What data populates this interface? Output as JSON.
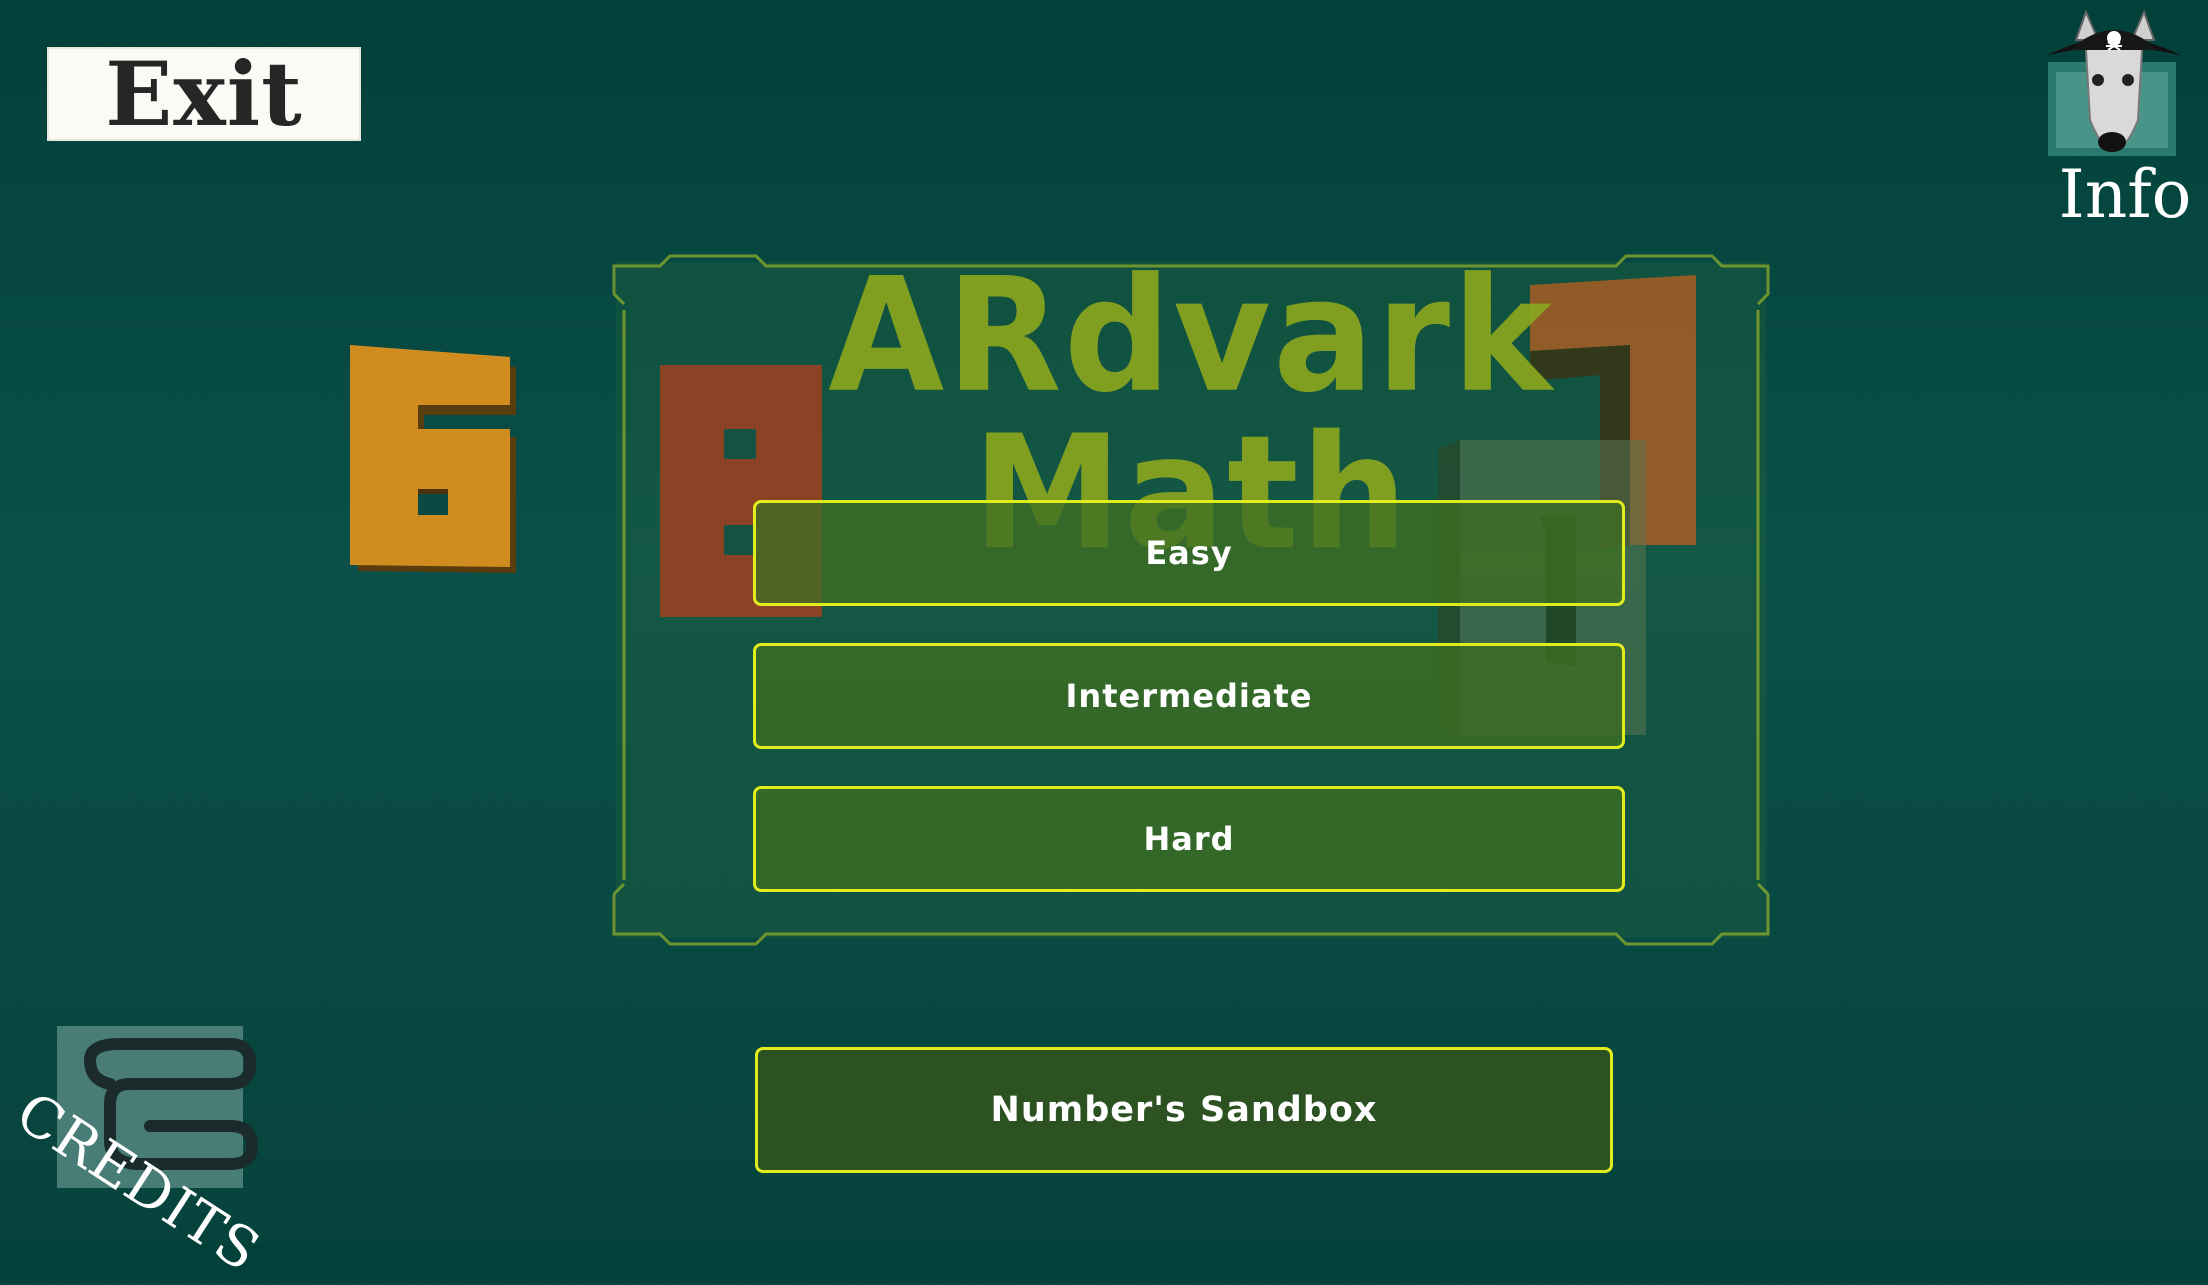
{
  "header": {
    "exit_label": "Exit",
    "info_label": "Info"
  },
  "title": "ARdvark Math",
  "menu": {
    "easy_label": "Easy",
    "intermediate_label": "Intermediate",
    "hard_label": "Hard",
    "sandbox_label": "Number's Sandbox"
  },
  "credits_label": "CREDITS",
  "decor": {
    "numbers": [
      "6",
      "8",
      "7",
      "1"
    ]
  },
  "colors": {
    "accent_border": "#e1ec1c",
    "title_color": "#8aa61f",
    "button_fill": "#3e6e22",
    "background": "#07433d"
  },
  "icons": {
    "info": "pirate-aardvark-icon",
    "credits": "scroll-icon"
  }
}
